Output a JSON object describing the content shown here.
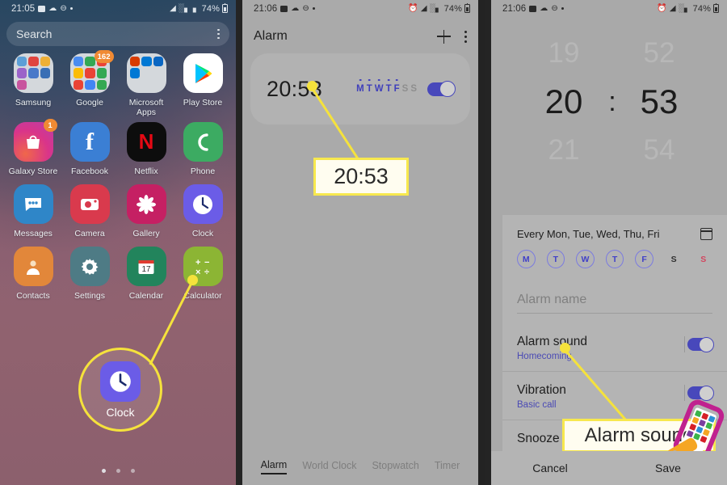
{
  "panels": {
    "home": {
      "status": {
        "time": "21:05",
        "battery": "74%",
        "icons": [
          "image-icon",
          "cloud-icon",
          "dnd-icon",
          "dot-icon",
          "wifi-icon",
          "signal-icon",
          "signal2-icon"
        ]
      },
      "search": {
        "placeholder": "Search",
        "menu_icon": "kebab-menu-icon"
      },
      "apps": [
        [
          {
            "label": "Samsung",
            "type": "folder",
            "colors": [
              "#5c9fd6",
              "#e0443e",
              "#efb036",
              "#9b63c9",
              "#4a79c9",
              "#3a6fb5",
              "#c8549e",
              "#d4d8dc",
              "#d4d8dc"
            ],
            "badge": ""
          },
          {
            "label": "Google",
            "type": "folder",
            "colors": [
              "#4a8cf0",
              "#34a853",
              "#ea4335",
              "#fbbc05",
              "#ea4335",
              "#34a853",
              "#ea4335",
              "#4285f4",
              "#34a853"
            ],
            "badge": "162"
          },
          {
            "label": "Microsoft\nApps",
            "type": "folder",
            "colors": [
              "#d83b01",
              "#0078d4",
              "#0a66c2",
              "#0078d4",
              "#d4d8dc",
              "#d4d8dc",
              "#d4d8dc",
              "#d4d8dc",
              "#d4d8dc"
            ],
            "badge": ""
          },
          {
            "label": "Play Store",
            "type": "playstore",
            "colors": [
              "#ffffff"
            ],
            "badge": ""
          }
        ],
        [
          {
            "label": "Galaxy Store",
            "type": "bag",
            "colors": [
              "#d9348a"
            ],
            "badge": "1"
          },
          {
            "label": "Facebook",
            "type": "facebook",
            "colors": [
              "#3b7fd4"
            ],
            "badge": ""
          },
          {
            "label": "Netflix",
            "type": "netflix",
            "colors": [
              "#0d0d0d"
            ],
            "badge": ""
          },
          {
            "label": "Phone",
            "type": "phone",
            "colors": [
              "#3cab62"
            ],
            "badge": ""
          }
        ],
        [
          {
            "label": "Messages",
            "type": "messages",
            "colors": [
              "#2f86c8"
            ],
            "badge": ""
          },
          {
            "label": "Camera",
            "type": "camera",
            "colors": [
              "#d93a4d"
            ],
            "badge": ""
          },
          {
            "label": "Gallery",
            "type": "gallery",
            "colors": [
              "#c52063"
            ],
            "badge": ""
          },
          {
            "label": "Clock",
            "type": "clock",
            "colors": [
              "#6b5ce7"
            ],
            "badge": ""
          }
        ],
        [
          {
            "label": "Contacts",
            "type": "contacts",
            "colors": [
              "#e2873a"
            ],
            "badge": ""
          },
          {
            "label": "Settings",
            "type": "settings",
            "colors": [
              "#4e7b85"
            ],
            "badge": ""
          },
          {
            "label": "Calendar",
            "type": "calendar",
            "colors": [
              "#22845c"
            ],
            "badge": ""
          },
          {
            "label": "Calculator",
            "type": "calculator",
            "colors": [
              "#8cb534"
            ],
            "badge": ""
          }
        ]
      ],
      "highlight": {
        "label": "Clock",
        "color": "#f5e23c"
      },
      "page_dots": 3,
      "active_dot": 0
    },
    "alarm": {
      "status": {
        "time": "21:06",
        "battery": "74%"
      },
      "header": {
        "title": "Alarm",
        "add_icon": "plus-icon",
        "menu_icon": "kebab-menu-icon"
      },
      "alarm_item": {
        "time": "20:53",
        "days": [
          {
            "letter": "M",
            "on": true
          },
          {
            "letter": "T",
            "on": true
          },
          {
            "letter": "W",
            "on": true
          },
          {
            "letter": "T",
            "on": true
          },
          {
            "letter": "F",
            "on": true
          },
          {
            "letter": "S",
            "on": false
          },
          {
            "letter": "S",
            "on": false
          }
        ],
        "enabled": true
      },
      "tabs": [
        {
          "label": "Alarm",
          "active": true
        },
        {
          "label": "World Clock",
          "active": false
        },
        {
          "label": "Stopwatch",
          "active": false
        },
        {
          "label": "Timer",
          "active": false
        }
      ],
      "callout": {
        "text": "20:53"
      }
    },
    "edit": {
      "status": {
        "time": "21:06",
        "battery": "74%"
      },
      "timepicker": {
        "hours": [
          "19",
          "20",
          "21"
        ],
        "minutes": [
          "52",
          "53",
          "54"
        ],
        "selected_hour": "20",
        "selected_minute": "53",
        "separator": ":"
      },
      "repeat": {
        "text": "Every Mon, Tue, Wed, Thu, Fri",
        "calendar_icon": "calendar-icon"
      },
      "day_circles": [
        {
          "letter": "M",
          "state": "on"
        },
        {
          "letter": "T",
          "state": "on"
        },
        {
          "letter": "W",
          "state": "on"
        },
        {
          "letter": "T",
          "state": "on"
        },
        {
          "letter": "F",
          "state": "on"
        },
        {
          "letter": "S",
          "state": "plain"
        },
        {
          "letter": "S",
          "state": "sun"
        }
      ],
      "alarm_name": {
        "placeholder": "Alarm name",
        "value": ""
      },
      "settings": [
        {
          "title": "Alarm sound",
          "subtitle": "Homecoming",
          "toggle": true
        },
        {
          "title": "Vibration",
          "subtitle": "Basic call",
          "toggle": true
        },
        {
          "title": "Snooze",
          "subtitle": "",
          "toggle": true
        }
      ],
      "buttons": {
        "cancel": "Cancel",
        "save": "Save"
      },
      "callout": {
        "text": "Alarm sound"
      }
    }
  },
  "colors": {
    "highlight": "#f5e23c",
    "accent_blue": "#4848bb",
    "link_blue": "#4a4ab4",
    "sunday_red": "#d2465f"
  }
}
